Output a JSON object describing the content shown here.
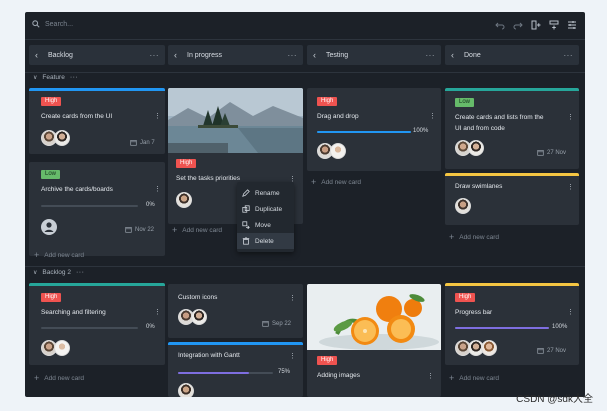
{
  "toolbar": {
    "search_placeholder": "Search...",
    "icons": [
      "undo-icon",
      "redo-icon",
      "add-column-icon",
      "add-row-icon",
      "sort-icon"
    ]
  },
  "columns": [
    {
      "title": "Backlog"
    },
    {
      "title": "In progress"
    },
    {
      "title": "Testing"
    },
    {
      "title": "Done"
    }
  ],
  "rows": [
    {
      "title": "Feature"
    },
    {
      "title": "Backlog 2"
    }
  ],
  "cards": {
    "c1": {
      "badge": "High",
      "title": "Create cards from the UI",
      "date": "Jan 7"
    },
    "c2": {
      "badge": "Low",
      "title": "Archive the cards/boards",
      "progress": "0%",
      "date": "Nov 22"
    },
    "c3": {
      "badge": "High",
      "title": "Set the tasks priorities"
    },
    "c4": {
      "badge": "High",
      "title": "Drag and drop",
      "progress": "100%"
    },
    "c5": {
      "badge": "Low",
      "title_line1": "Create cards and lists from the",
      "title_line2": "UI and from code",
      "date": "27 Nov"
    },
    "c6": {
      "title": "Draw swimlanes"
    },
    "c7": {
      "badge": "High",
      "title": "Searching and filtering",
      "progress": "0%"
    },
    "c8": {
      "title": "Custom icons",
      "date": "Sep 22"
    },
    "c9": {
      "title": "Integration with Gantt",
      "progress": "75%"
    },
    "c10": {
      "badge": "High",
      "title": "Adding images"
    },
    "c11": {
      "badge": "High",
      "title": "Progress bar",
      "progress": "100%",
      "date": "27 Nov"
    }
  },
  "progress_values": {
    "c2": 0,
    "c4": 1.0,
    "c7": 0,
    "c9": 0.75,
    "c11": 1.0
  },
  "add_card_label": "Add new card",
  "context_menu": {
    "items": [
      {
        "label": "Rename",
        "icon": "pencil-icon"
      },
      {
        "label": "Duplicate",
        "icon": "copy-icon"
      },
      {
        "label": "Move",
        "icon": "move-icon"
      },
      {
        "label": "Delete",
        "icon": "trash-icon"
      }
    ]
  },
  "watermark": "CSDN @sdk大全",
  "colors": {
    "board_bg": "#1c2128",
    "card_bg": "#2b3139",
    "high": "#ef5350",
    "low": "#66bb6a",
    "blue": "#2196f3",
    "teal": "#26a69a",
    "yellow": "#f4c542",
    "purple": "#7e6ee0"
  }
}
